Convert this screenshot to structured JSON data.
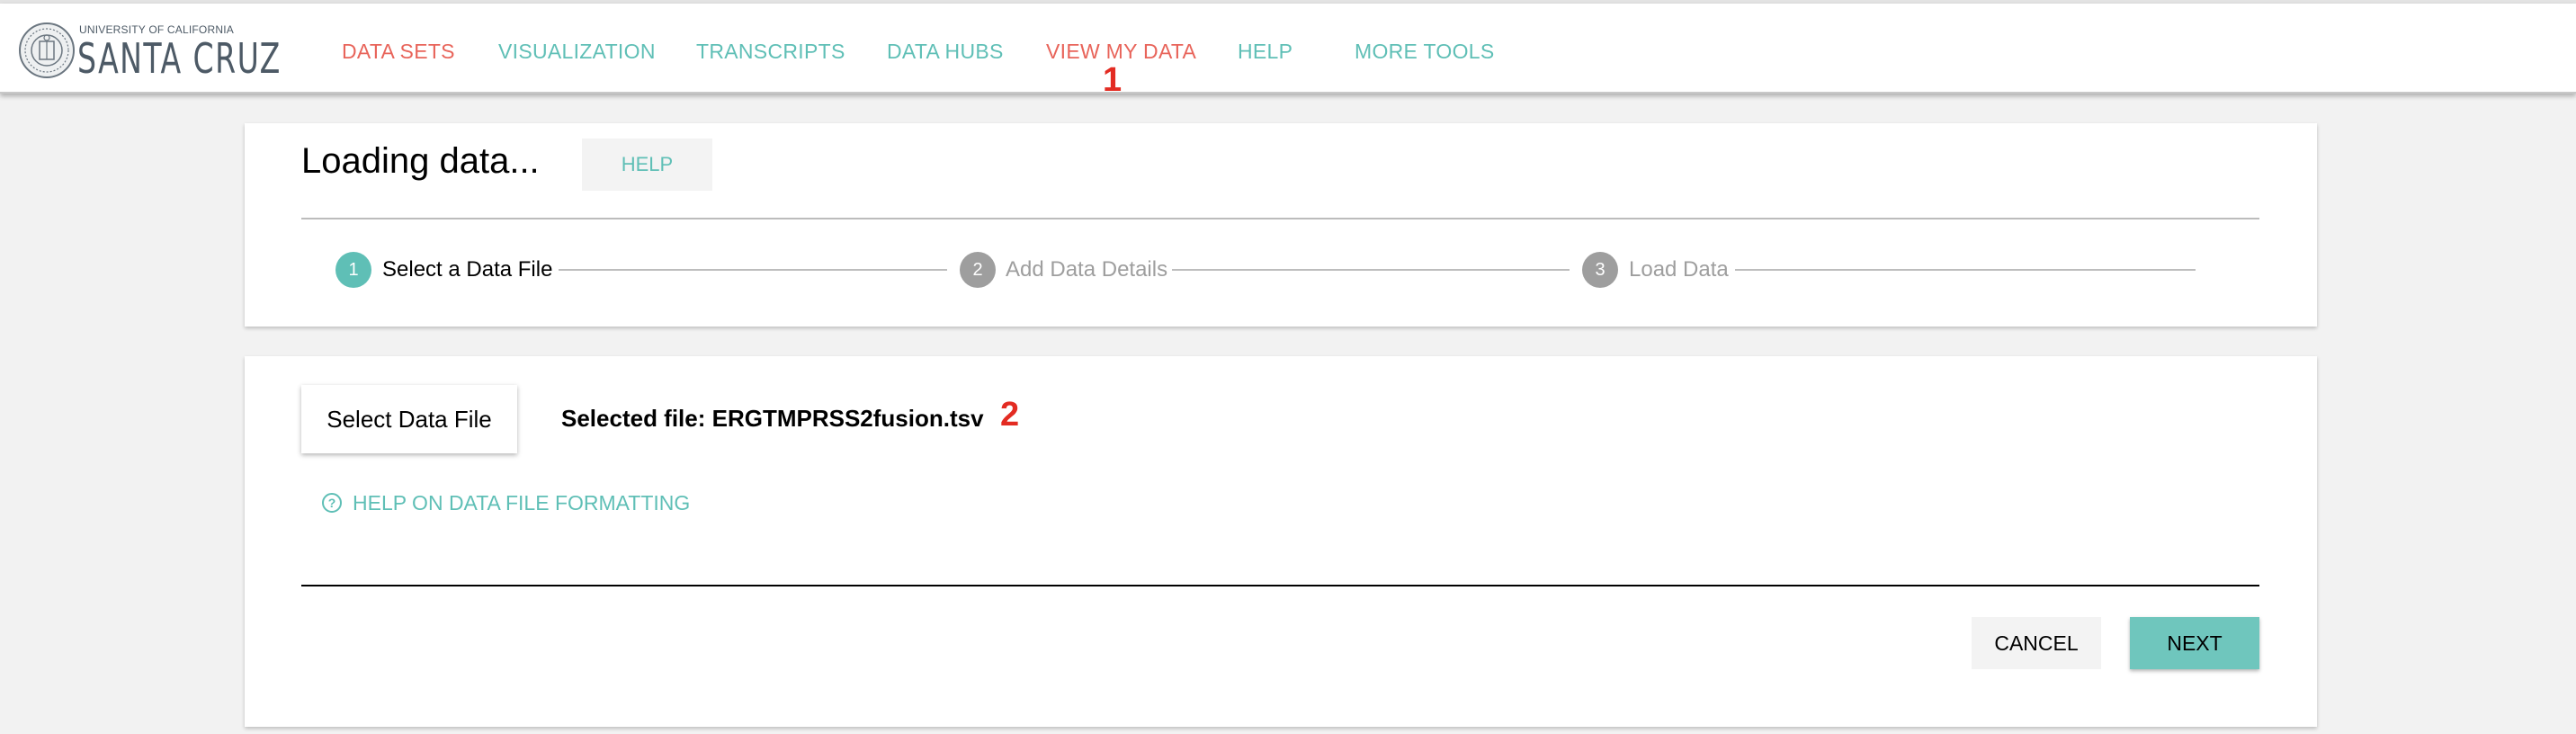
{
  "logo": {
    "small_text": "UNIVERSITY OF CALIFORNIA",
    "big_text": "SANTA CRUZ"
  },
  "nav": {
    "items": [
      {
        "label": "DATA SETS"
      },
      {
        "label": "VISUALIZATION"
      },
      {
        "label": "TRANSCRIPTS"
      },
      {
        "label": "DATA HUBS"
      },
      {
        "label": "VIEW MY DATA"
      },
      {
        "label": "HELP"
      },
      {
        "label": "MORE TOOLS"
      }
    ]
  },
  "markers": {
    "one": "1",
    "two": "2"
  },
  "wizard": {
    "title": "Loading data...",
    "help_label": "HELP",
    "steps": [
      {
        "number": "1",
        "label": "Select a Data File"
      },
      {
        "number": "2",
        "label": "Add Data Details"
      },
      {
        "number": "3",
        "label": "Load Data"
      }
    ]
  },
  "file_step": {
    "select_button": "Select Data File",
    "selected_file": "Selected file: ERGTMPRSS2fusion.tsv",
    "format_help_icon": "?",
    "format_help": "HELP ON DATA FILE FORMATTING",
    "cancel": "CANCEL",
    "next": "NEXT"
  },
  "colors": {
    "teal": "#5fbfb6",
    "red": "#e8645a",
    "marker_red": "#e32b22",
    "next_button": "#6fc6bd",
    "inactive_step": "#9e9e9e"
  }
}
